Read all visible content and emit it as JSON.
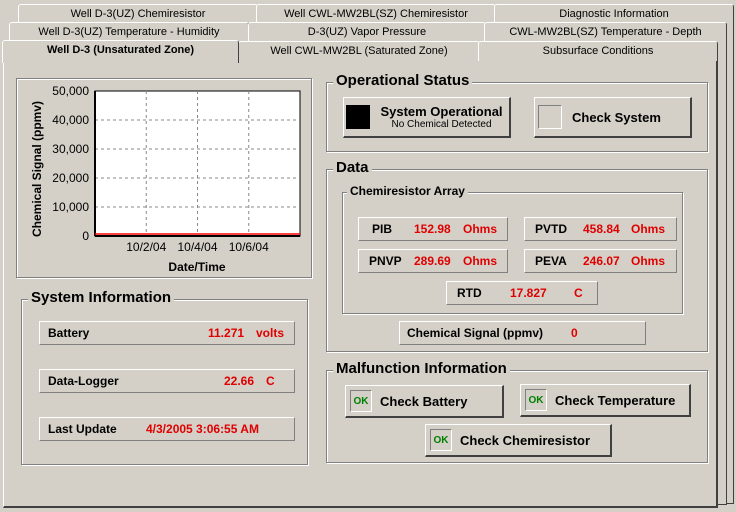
{
  "tabs": {
    "row1": [
      "Well D-3(UZ) Chemiresistor",
      "Well CWL-MW2BL(SZ) Chemiresistor",
      "Diagnostic Information"
    ],
    "row2": [
      "Well D-3(UZ) Temperature - Humidity",
      "D-3(UZ) Vapor Pressure",
      "CWL-MW2BL(SZ) Temperature - Depth"
    ],
    "row3": [
      "Well D-3 (Unsaturated Zone)",
      "Well CWL-MW2BL (Saturated Zone)",
      "Subsurface Conditions"
    ]
  },
  "chart_data": {
    "type": "line",
    "ylabel": "Chemical Signal (ppmv)",
    "xlabel": "Date/Time",
    "y_ticks": [
      "50,000",
      "40,000",
      "30,000",
      "20,000",
      "10,000",
      "0"
    ],
    "x_ticks": [
      "10/2/04",
      "10/4/04",
      "10/6/04"
    ],
    "ylim": [
      0,
      50000
    ],
    "grid": true,
    "series": [
      {
        "color": "#ff0000",
        "values": [
          0,
          0,
          0,
          0,
          0
        ]
      }
    ]
  },
  "system_info": {
    "title": "System Information",
    "battery": {
      "label": "Battery",
      "value": "11.271",
      "unit": "volts"
    },
    "datalogger": {
      "label": "Data-Logger",
      "value": "22.66",
      "unit": "C"
    },
    "last_update": {
      "label": "Last Update",
      "value": "4/3/2005 3:06:55 AM"
    }
  },
  "operational": {
    "title": "Operational Status",
    "status_label": "System Operational",
    "status_sub": "No Chemical Detected",
    "check_label": "Check System"
  },
  "data": {
    "title": "Data",
    "array_title": "Chemiresistor Array",
    "pib": {
      "label": "PIB",
      "value": "152.98",
      "unit": "Ohms"
    },
    "pvtd": {
      "label": "PVTD",
      "value": "458.84",
      "unit": "Ohms"
    },
    "pnvp": {
      "label": "PNVP",
      "value": "289.69",
      "unit": "Ohms"
    },
    "peva": {
      "label": "PEVA",
      "value": "246.07",
      "unit": "Ohms"
    },
    "rtd": {
      "label": "RTD",
      "value": "17.827",
      "unit": "C"
    },
    "signal": {
      "label": "Chemical Signal (ppmv)",
      "value": "0"
    }
  },
  "malfunction": {
    "title": "Malfunction Information",
    "ok": "OK",
    "battery": "Check Battery",
    "temperature": "Check Temperature",
    "chemiresistor": "Check Chemiresistor"
  }
}
